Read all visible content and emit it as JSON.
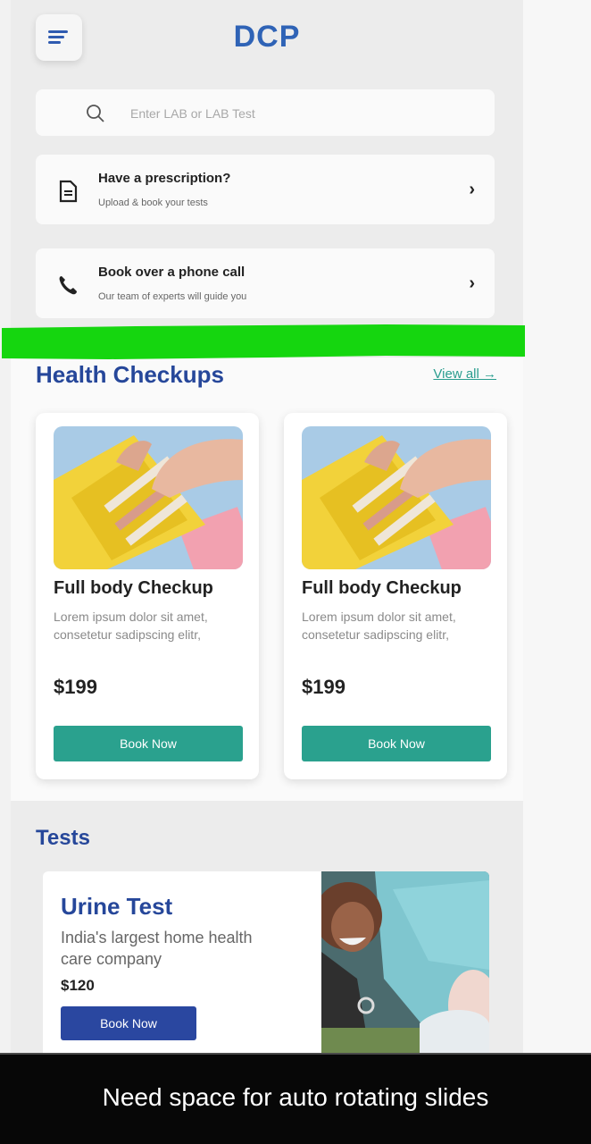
{
  "app": {
    "brand": "DCP"
  },
  "search": {
    "placeholder": "Enter LAB or LAB Test"
  },
  "actions": [
    {
      "title": "Have a prescription?",
      "subtitle": "Upload & book your tests",
      "icon": "document-icon"
    },
    {
      "title": "Book over a phone call",
      "subtitle": "Our team of experts will guide you",
      "icon": "phone-icon"
    }
  ],
  "annotation_color": "#15d60f",
  "health": {
    "title": "Health Checkups",
    "view_all": "View all →",
    "cards": [
      {
        "title": "Full body Checkup",
        "desc": "Lorem ipsum dolor sit amet, consetetur sadipscing elitr,",
        "price": "$199",
        "button": "Book Now"
      },
      {
        "title": "Full body Checkup",
        "desc": "Lorem ipsum dolor sit amet, consetetur sadipscing elitr,",
        "price": "$199",
        "button": "Book Now"
      }
    ]
  },
  "tests": {
    "title": "Tests",
    "card": {
      "title": "Urine Test",
      "desc": "India's largest home health care company",
      "price": "$120",
      "button": "Book Now"
    }
  },
  "caption": "Need space for auto rotating slides",
  "colors": {
    "brand": "#2f63b6",
    "teal": "#2aa18e",
    "navy": "#2a47a0"
  }
}
